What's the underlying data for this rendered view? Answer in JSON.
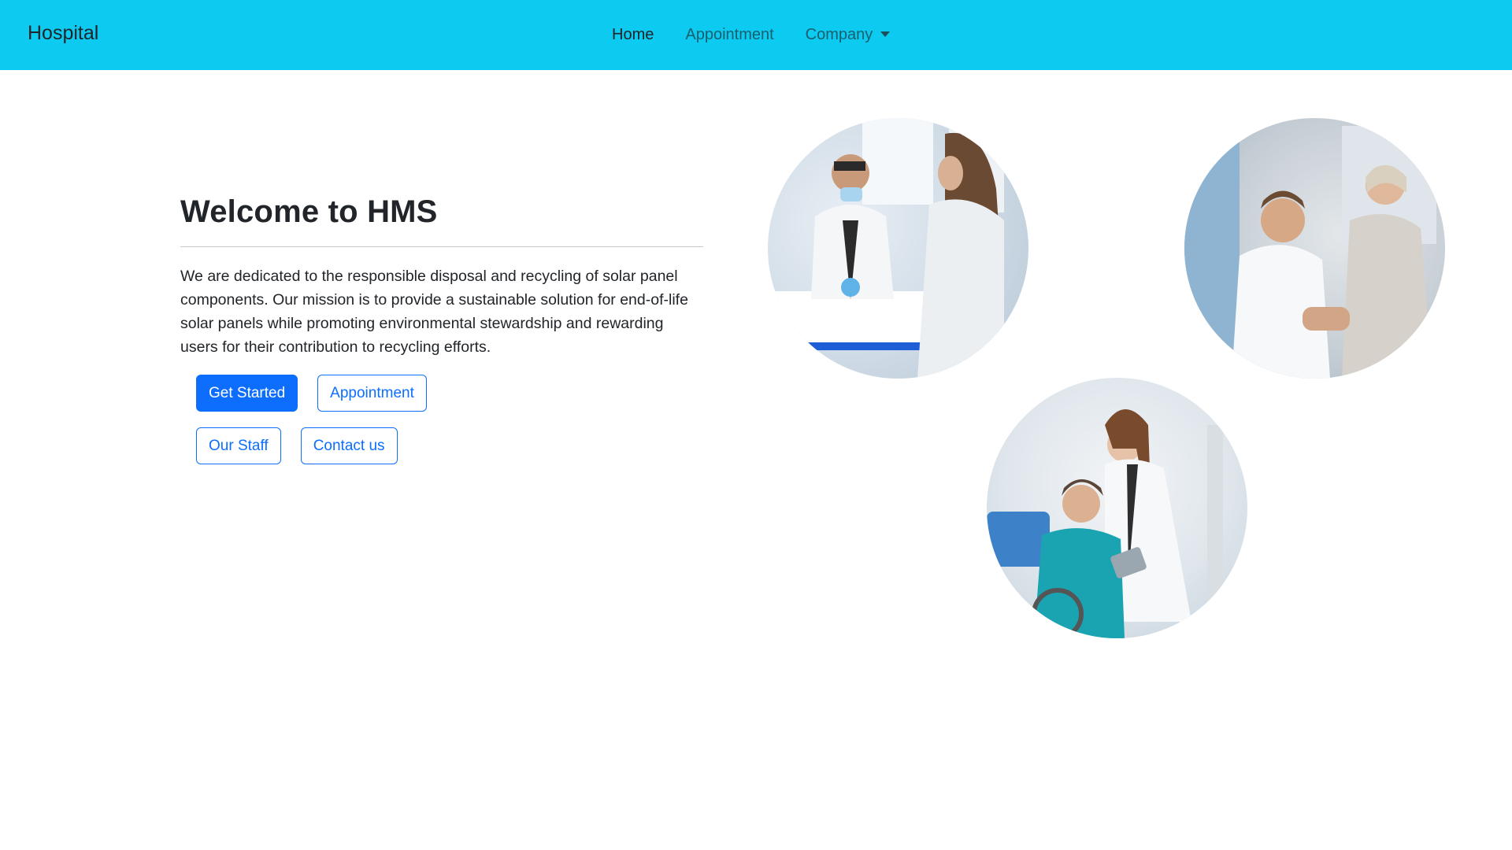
{
  "navbar": {
    "brand": "Hospital",
    "links": [
      {
        "label": "Home",
        "active": true
      },
      {
        "label": "Appointment",
        "active": false
      },
      {
        "label": "Company",
        "active": false,
        "dropdown": true
      }
    ],
    "background_color": "#0dcaf0"
  },
  "hero": {
    "title": "Welcome to HMS",
    "text": "We are dedicated to the responsible disposal and recycling of solar panel components. Our mission is to provide a sustainable solution for end-of-life solar panels while promoting environmental stewardship and rewarding users for their contribution to recycling efforts.",
    "buttons": {
      "get_started": "Get Started",
      "appointment": "Appointment",
      "our_staff": "Our Staff",
      "contact_us": "Contact us"
    }
  },
  "images": [
    {
      "icon": "doctor-patient-consultation-photo"
    },
    {
      "icon": "doctor-elderly-patient-photo"
    },
    {
      "icon": "doctor-wheelchair-patient-photo"
    }
  ],
  "colors": {
    "primary": "#0d6efd",
    "navbar": "#0dcaf0",
    "text": "#212529"
  }
}
